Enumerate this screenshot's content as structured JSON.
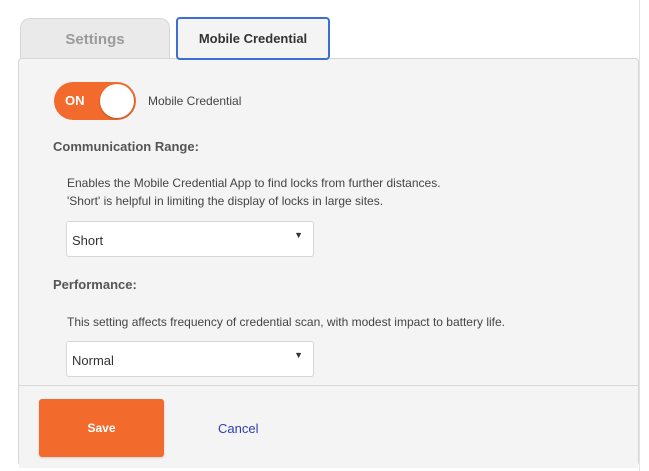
{
  "tabs": {
    "settings": "Settings",
    "mobile_credential": "Mobile Credential"
  },
  "toggle": {
    "state_label": "ON",
    "caption": "Mobile Credential",
    "checked": true
  },
  "communication_range": {
    "heading": "Communication Range:",
    "description_line1": "Enables the Mobile Credential App to find locks from further distances.",
    "description_line2": "'Short' is helpful in limiting the display of locks in large sites.",
    "selected": "Short"
  },
  "performance": {
    "heading": "Performance:",
    "description": "This setting affects frequency of credential scan, with modest impact to battery life.",
    "selected": "Normal"
  },
  "footer": {
    "save_label": "Save",
    "cancel_label": "Cancel"
  },
  "colors": {
    "accent": "#f26b2c",
    "tab_focus": "#3b6fd6",
    "link": "#2e3db4"
  },
  "icons": {
    "dropdown": "triangle-down-icon"
  }
}
